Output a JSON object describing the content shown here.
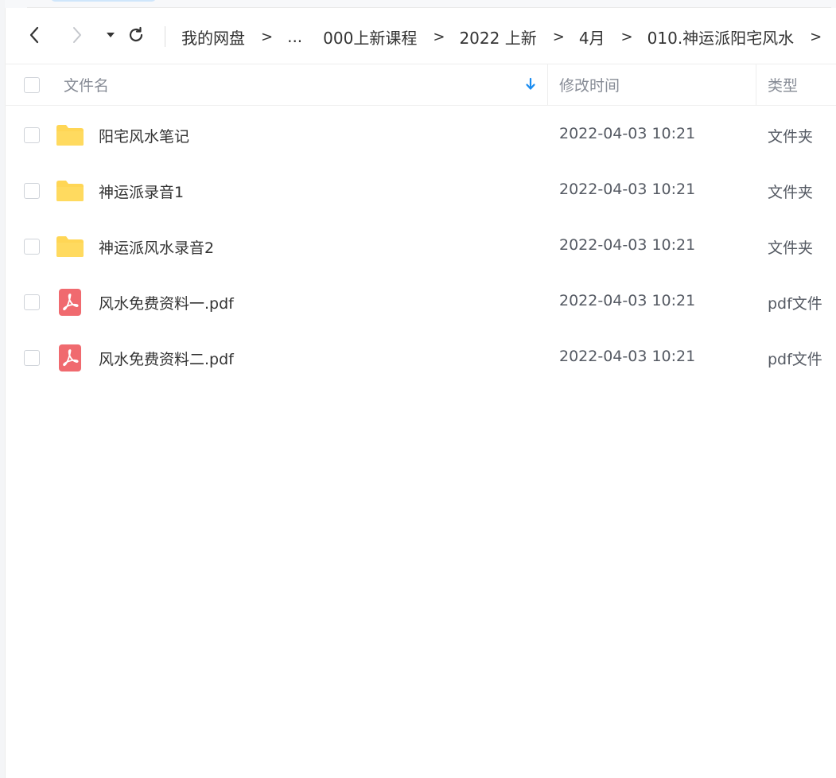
{
  "toolbar": {
    "breadcrumb": [
      {
        "label": "我的网盘"
      },
      {
        "label": "..."
      },
      {
        "label": "000上新课程"
      },
      {
        "label": "2022 上新"
      },
      {
        "label": "4月"
      },
      {
        "label": "010.神运派阳宅风水"
      }
    ],
    "separator": ">"
  },
  "header": {
    "name": "文件名",
    "modified": "修改时间",
    "type": "类型"
  },
  "files": [
    {
      "name": "阳宅风水笔记",
      "modified": "2022-04-03 10:21",
      "type": "文件夹",
      "icon": "folder-icon"
    },
    {
      "name": "神运派录音1",
      "modified": "2022-04-03 10:21",
      "type": "文件夹",
      "icon": "folder-icon"
    },
    {
      "name": "神运派风水录音2",
      "modified": "2022-04-03 10:21",
      "type": "文件夹",
      "icon": "folder-icon"
    },
    {
      "name": "风水免费资料一.pdf",
      "modified": "2022-04-03 10:21",
      "type": "pdf文件",
      "icon": "pdf-icon"
    },
    {
      "name": "风水免费资料二.pdf",
      "modified": "2022-04-03 10:21",
      "type": "pdf文件",
      "icon": "pdf-icon"
    }
  ],
  "colors": {
    "folder": "#ffd655",
    "pdf": "#f06a6f",
    "accent": "#1a8cf0"
  }
}
